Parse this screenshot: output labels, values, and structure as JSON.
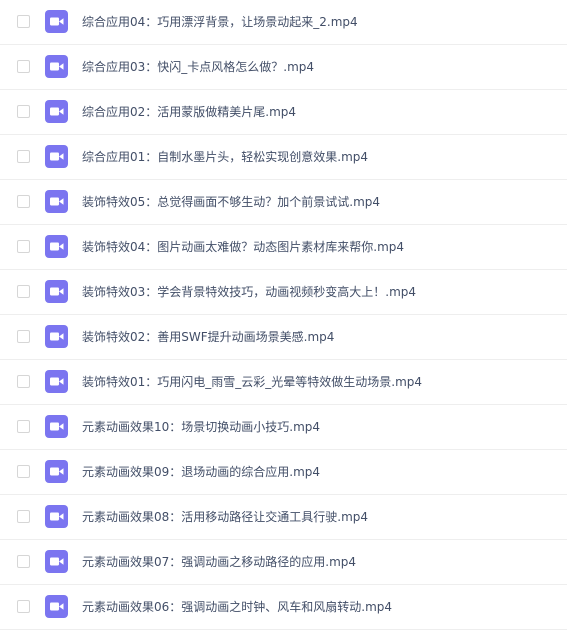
{
  "file_icon": "video-file-icon",
  "icon_color": "#7b75f0",
  "files": [
    {
      "name": "综合应用04：巧用漂浮背景，让场景动起来_2.mp4"
    },
    {
      "name": "综合应用03：快闪_卡点风格怎么做？.mp4"
    },
    {
      "name": "综合应用02：活用蒙版做精美片尾.mp4"
    },
    {
      "name": "综合应用01：自制水墨片头，轻松实现创意效果.mp4"
    },
    {
      "name": "装饰特效05：总觉得画面不够生动？加个前景试试.mp4"
    },
    {
      "name": "装饰特效04：图片动画太难做？动态图片素材库来帮你.mp4"
    },
    {
      "name": "装饰特效03：学会背景特效技巧，动画视频秒变高大上！.mp4"
    },
    {
      "name": "装饰特效02：善用SWF提升动画场景美感.mp4"
    },
    {
      "name": "装饰特效01：巧用闪电_雨雪_云彩_光晕等特效做生动场景.mp4"
    },
    {
      "name": "元素动画效果10：场景切换动画小技巧.mp4"
    },
    {
      "name": "元素动画效果09：退场动画的综合应用.mp4"
    },
    {
      "name": "元素动画效果08：活用移动路径让交通工具行驶.mp4"
    },
    {
      "name": "元素动画效果07：强调动画之移动路径的应用.mp4"
    },
    {
      "name": "元素动画效果06：强调动画之时钟、风车和风扇转动.mp4"
    }
  ]
}
